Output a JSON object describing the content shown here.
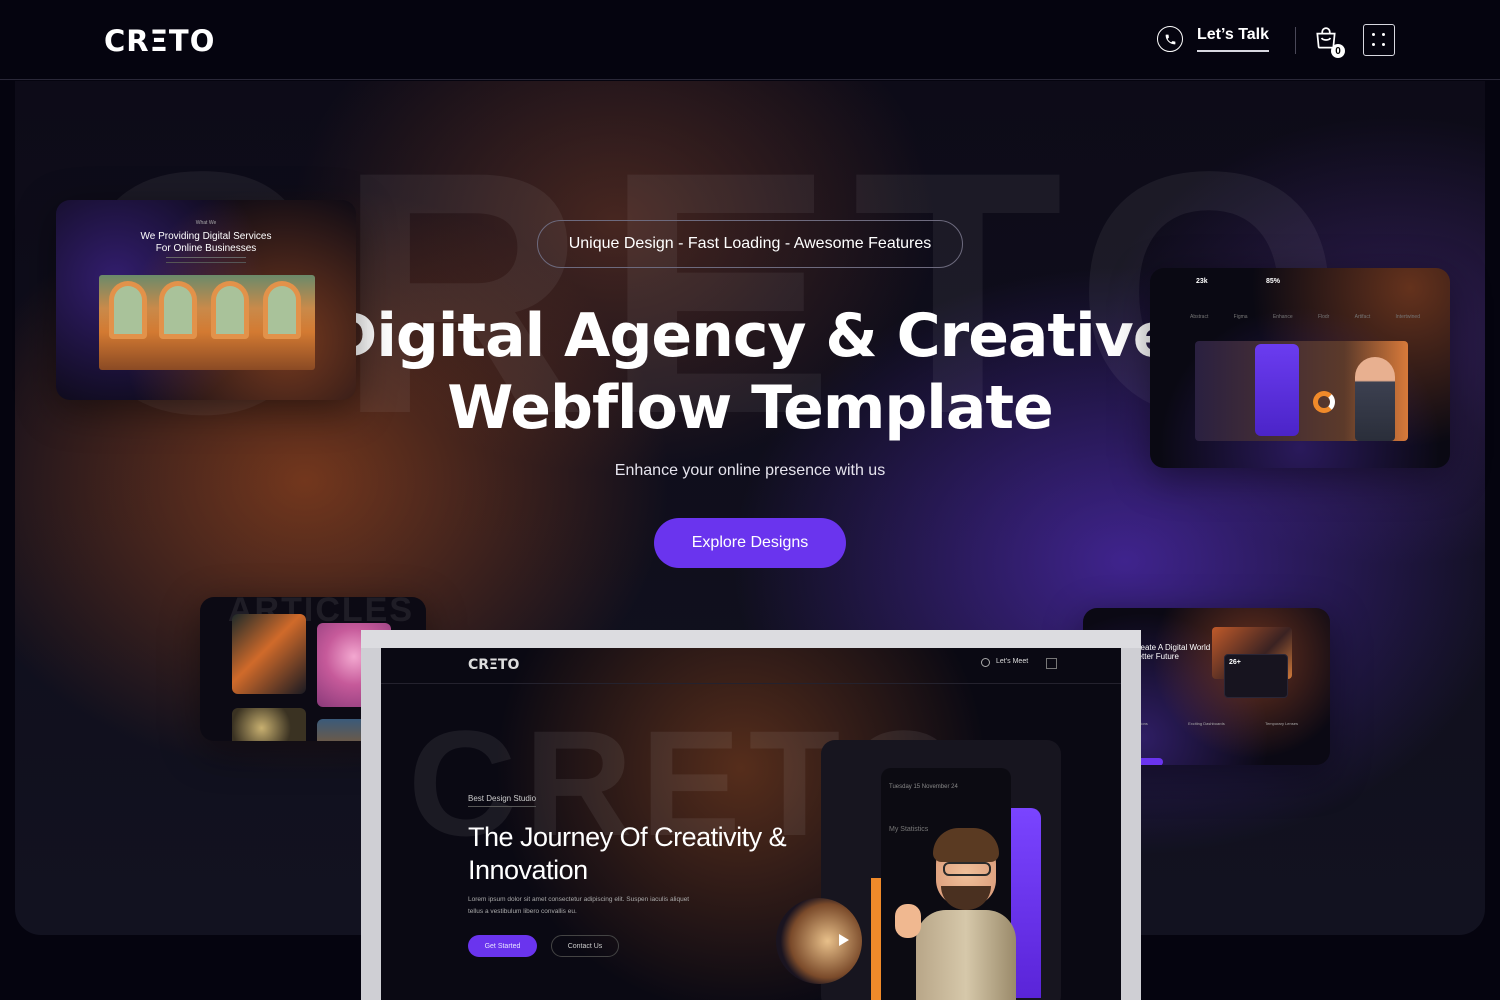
{
  "nav": {
    "logo": "CRΞTO",
    "talk_label": "Let’s Talk",
    "cart_count": "0",
    "icons": [
      "phone-icon",
      "cart-icon",
      "menu-grid-icon"
    ]
  },
  "hero": {
    "watermark": "CRETO",
    "pill_text": "Unique Design - Fast Loading - Awesome Features",
    "title_line1": "Digital Agency & Creative",
    "title_line2": "Webflow Template",
    "subtitle": "Enhance your online presence with us",
    "cta_label": "Explore Designs"
  },
  "card_top_left": {
    "label": "What We",
    "title": "We Providing Digital Services For Online Businesses"
  },
  "card_top_right": {
    "stat1": "23k",
    "stat2": "85%",
    "logos": [
      "Abstract",
      "Figma",
      "Enhance",
      "Flodr",
      "Artifact",
      "Intertwined"
    ]
  },
  "card_bottom_left": {
    "watermark": "ARTICLES"
  },
  "card_bottom_right": {
    "title": "We Create A Digital World For Better Future",
    "stat": "26+",
    "features": [
      "Scaled Solutions",
      "Exciting Dashboards",
      "Temporary Lenses"
    ]
  },
  "mockup": {
    "logo": "CRΞTO",
    "talk": "Let’s Meet",
    "watermark": "CRETO",
    "eyebrow": "Best Design Studio",
    "headline": "The Journey Of Creativity & Innovation",
    "body": "Lorem ipsum dolor sit amet consectetur adipiscing elit. Suspen iaculis aliquet tellus a vestibulum libero convallis eu.",
    "btn_primary": "Get Started",
    "btn_secondary": "Contact Us",
    "phone_date": "Tuesday 15 November 24",
    "phone_stats": "My Statistics"
  },
  "colors": {
    "accent": "#6a34ee",
    "background": "#05040f",
    "orange_glow": "#b0501e"
  }
}
